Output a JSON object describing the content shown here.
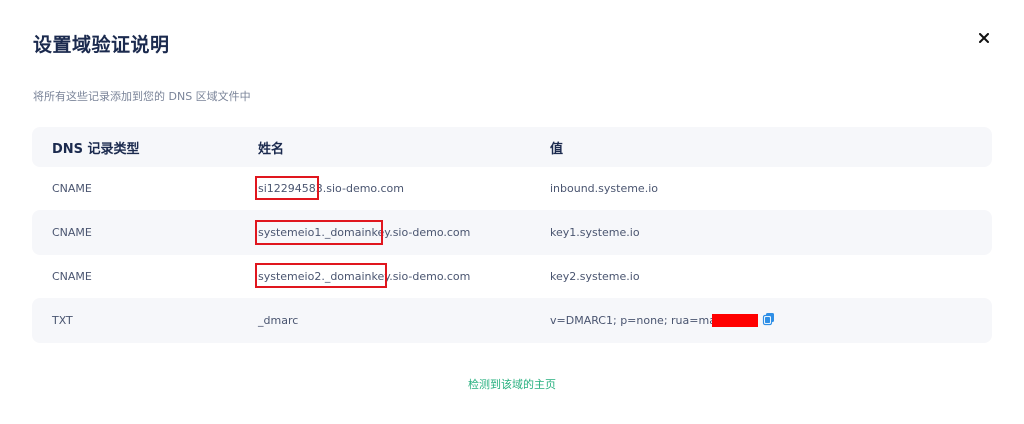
{
  "dialog": {
    "title": "设置域验证说明",
    "subtitle": "将所有这些记录添加到您的 DNS 区域文件中",
    "close_icon": "close-icon"
  },
  "table": {
    "headers": [
      "DNS 记录类型",
      "姓名",
      "值"
    ],
    "rows": [
      {
        "type": "CNAME",
        "name": "si12294583.sio-demo.com",
        "value": "inbound.systeme.io"
      },
      {
        "type": "CNAME",
        "name": "systemeio1._domainkey.sio-demo.com",
        "value": "key1.systeme.io"
      },
      {
        "type": "CNAME",
        "name": "systemeio2._domainkey.sio-demo.com",
        "value": "key2.systeme.io"
      },
      {
        "type": "TXT",
        "name": "_dmarc",
        "value": "v=DMARC1; p=none; rua=mailto",
        "copy_icon": "copy-icon"
      }
    ]
  },
  "footer": {
    "link_label": "检测到该域的主页"
  },
  "colors": {
    "accent": "#27b07f",
    "redaction": "#ff0000",
    "row_background": "#f6f7fa"
  }
}
